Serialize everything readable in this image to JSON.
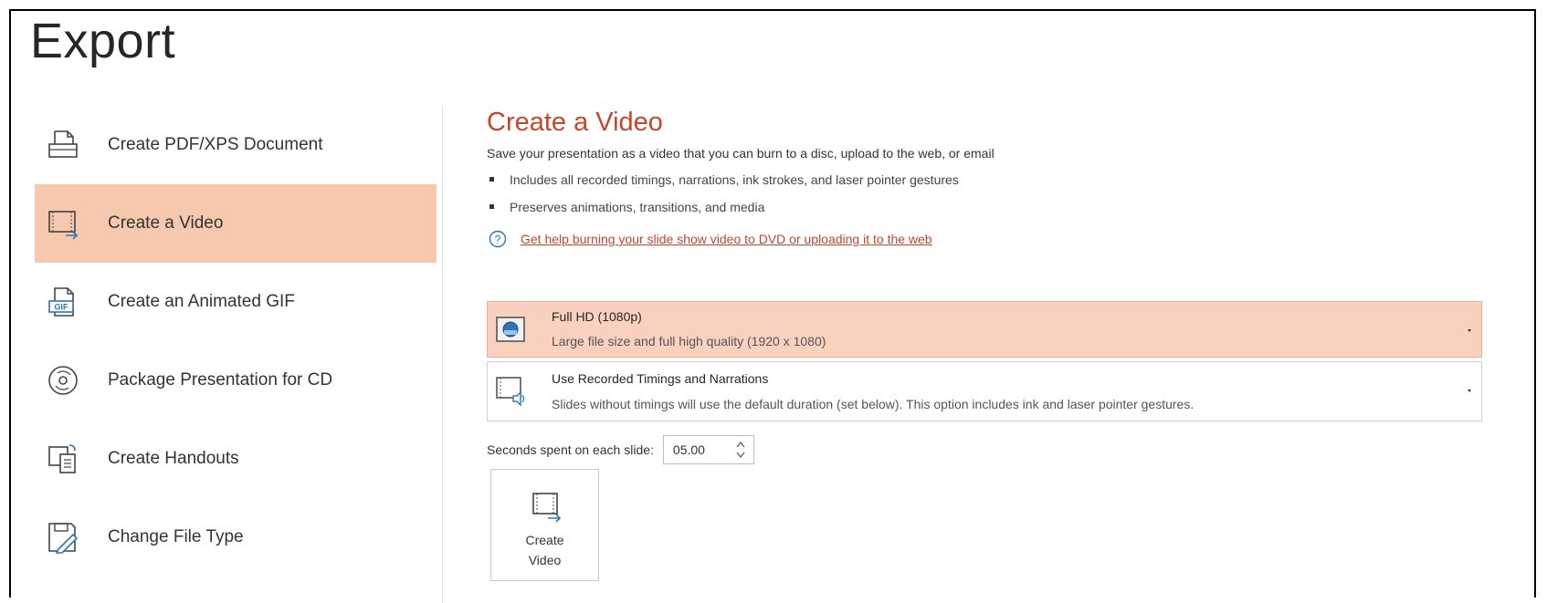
{
  "page": {
    "title": "Export"
  },
  "sidebar": {
    "items": [
      {
        "label": "Create PDF/XPS Document",
        "icon": "pdf-document-icon"
      },
      {
        "label": "Create a Video",
        "icon": "video-icon",
        "active": true
      },
      {
        "label": "Create an Animated GIF",
        "icon": "gif-icon"
      },
      {
        "label": "Package Presentation for CD",
        "icon": "cd-icon"
      },
      {
        "label": "Create Handouts",
        "icon": "handouts-icon"
      },
      {
        "label": "Change File Type",
        "icon": "change-file-type-icon"
      }
    ]
  },
  "main": {
    "title": "Create a Video",
    "description": "Save your presentation as a video that you can burn to a disc, upload to the web, or email",
    "bullets": [
      "Includes all recorded timings, narrations, ink strokes, and laser pointer gestures",
      "Preserves animations, transitions, and media"
    ],
    "help_link": "Get help burning your slide show video to DVD or uploading it to the web",
    "quality": {
      "title": "Full HD (1080p)",
      "subtitle": "Large file size and full high quality (1920 x 1080)"
    },
    "timings": {
      "title": "Use Recorded Timings and Narrations",
      "subtitle": "Slides without timings will use the default duration (set below). This option includes ink and laser pointer gestures."
    },
    "seconds": {
      "label": "Seconds spent on each slide:",
      "value": "05.00"
    },
    "create_button": {
      "line1": "Create",
      "line2": "Video"
    }
  },
  "colors": {
    "accent": "#c4472c",
    "active_bg": "#f6c8ad",
    "dropdown_selected_bg": "#fad1bf"
  }
}
